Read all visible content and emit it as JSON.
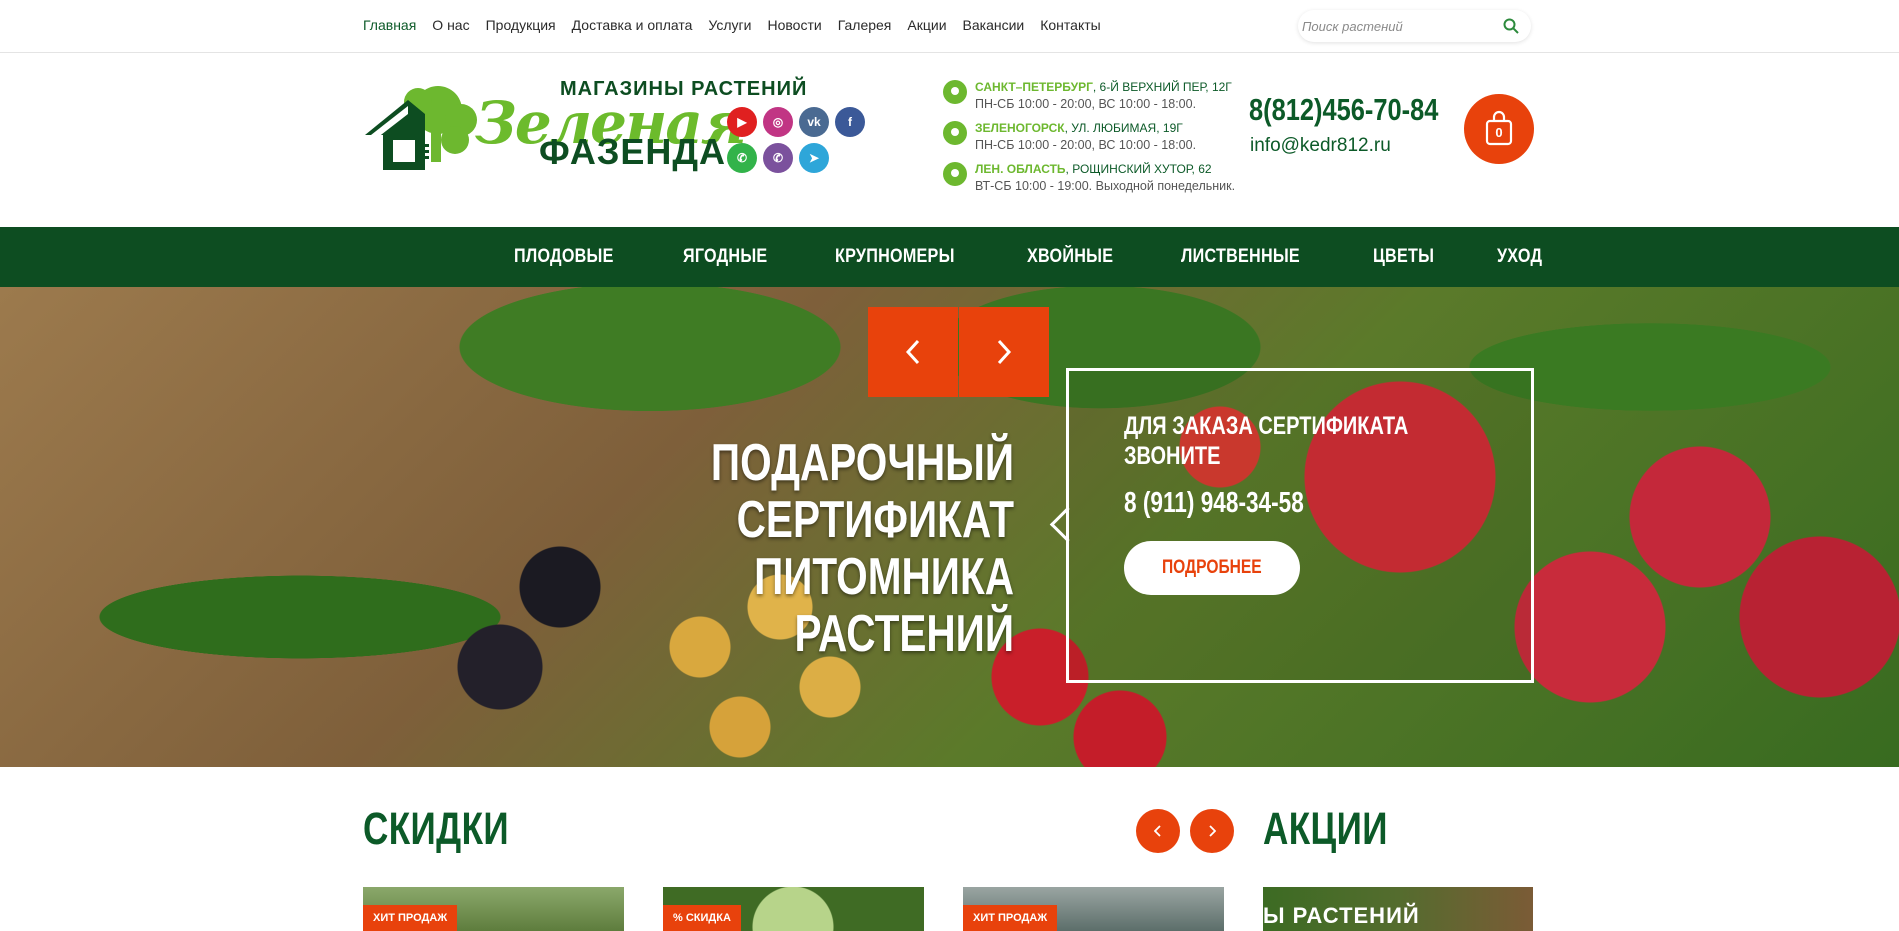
{
  "topnav": {
    "items": [
      "Главная",
      "О нас",
      "Продукция",
      "Доставка и оплата",
      "Услуги",
      "Новости",
      "Галерея",
      "Акции",
      "Вакансии",
      "Контакты"
    ]
  },
  "search": {
    "placeholder": "Поиск растений"
  },
  "logo": {
    "tagline": "МАГАЗИНЫ РАСТЕНИЙ",
    "script": "Зеленая",
    "name": "ФАЗЕНДА"
  },
  "social": [
    "youtube-icon",
    "instagram-icon",
    "vk-icon",
    "facebook-icon",
    "whatsapp-icon",
    "viber-icon",
    "telegram-icon"
  ],
  "addresses": [
    {
      "city": "САНКТ–ПЕТЕРБУРГ",
      "street": ", 6-Й ВЕРХНИЙ ПЕР, 12Г",
      "hours": "ПН-СБ 10:00 - 20:00, ВС 10:00 - 18:00."
    },
    {
      "city": "ЗЕЛЕНОГОРСК",
      "street": ", УЛ. ЛЮБИМАЯ, 19Г",
      "hours": "ПН-СБ 10:00 - 20:00, ВС 10:00 - 18:00."
    },
    {
      "city": "ЛЕН. ОБЛАСТЬ",
      "street": ", РОЩИНСКИЙ ХУТОР, 62",
      "hours": "ВТ-СБ 10:00 - 19:00. Выходной понедельник."
    }
  ],
  "contacts": {
    "phone": "8(812)456-70-84",
    "email": "info@kedr812.ru"
  },
  "cart": {
    "count": "0"
  },
  "categories": [
    "ПЛОДОВЫЕ",
    "ЯГОДНЫЕ",
    "КРУПНОМЕРЫ",
    "ХВОЙНЫЕ",
    "ЛИСТВЕННЫЕ",
    "ЦВЕТЫ",
    "УХОД"
  ],
  "hero": {
    "title_line1": "ПОДАРОЧНЫЙ СЕРТИФИКАТ",
    "title_line2": "ПИТОМНИКА РАСТЕНИЙ",
    "box_text_line1": "ДЛЯ ЗАКАЗА СЕРТИФИКАТА",
    "box_text_line2": "ЗВОНИТЕ",
    "box_phone": "8 (911) 948-34-58",
    "button": "ПОДРОБНЕЕ"
  },
  "sections": {
    "discounts_title": "СКИДКИ",
    "promos_title": "АКЦИИ",
    "cards": [
      {
        "badge": "ХИТ ПРОДАЖ"
      },
      {
        "badge": "% СКИДКА"
      },
      {
        "badge": "ХИТ ПРОДАЖ"
      }
    ],
    "promo_banner_text": "Ы РАСТЕНИЙ"
  },
  "colors": {
    "brand_green": "#0d4d21",
    "accent_orange": "#e8420c",
    "light_green": "#6db82f"
  }
}
